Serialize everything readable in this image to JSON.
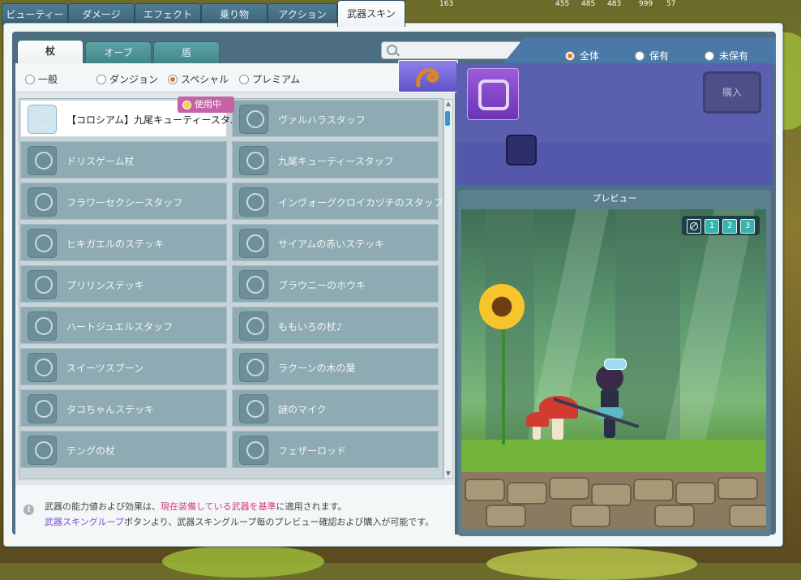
{
  "top_tabs": [
    {
      "label": "ビューティー"
    },
    {
      "label": "ダメージ"
    },
    {
      "label": "エフェクト"
    },
    {
      "label": "乗り物"
    },
    {
      "label": "アクション"
    },
    {
      "label": "武器スキン",
      "active": true
    }
  ],
  "hud_numbers": [
    "163",
    "455",
    "485",
    "483",
    "999",
    "57"
  ],
  "sub_tabs": [
    {
      "label": "杖",
      "active": true
    },
    {
      "label": "オーブ"
    },
    {
      "label": "盾"
    }
  ],
  "search": {
    "placeholder": "",
    "value": ""
  },
  "ownership_filter": [
    {
      "label": "全体",
      "selected": true
    },
    {
      "label": "保有",
      "selected": false
    },
    {
      "label": "未保有",
      "selected": false
    }
  ],
  "category_filter": [
    {
      "label": "一般",
      "selected": false
    },
    {
      "label": "ダンジョン",
      "selected": false
    },
    {
      "label": "スペシャル",
      "selected": true
    },
    {
      "label": "プレミアム",
      "selected": false
    }
  ],
  "in_use_badge": "使用中",
  "items": [
    {
      "name": "【コロシアム】九尾キューティースタ..",
      "selected": true,
      "icon": "staff-blue-icon"
    },
    {
      "name": "ヴァルハラスタッフ",
      "icon": "staff-ring-icon"
    },
    {
      "name": "ドリスゲーム杖",
      "icon": "staff-broom-icon"
    },
    {
      "name": "九尾キューティースタッフ",
      "icon": "staff-fox-icon"
    },
    {
      "name": "フラワーセクシースタッフ",
      "icon": "staff-flower-icon"
    },
    {
      "name": "インヴォーグクロイカヅチのスタッフ",
      "icon": "staff-lightning-icon"
    },
    {
      "name": "ヒキガエルのステッキ",
      "icon": "staff-toad-icon"
    },
    {
      "name": "サイアムの赤いステッキ",
      "icon": "staff-red-icon"
    },
    {
      "name": "プリリンステッキ",
      "icon": "staff-candy-icon"
    },
    {
      "name": "ブラウニーのホウキ",
      "icon": "broom-icon"
    },
    {
      "name": "ハートジュエルスタッフ",
      "icon": "staff-heart-icon"
    },
    {
      "name": "ももいろの杖♪",
      "icon": "staff-pink-icon"
    },
    {
      "name": "スイーツスプーン",
      "icon": "spoon-icon"
    },
    {
      "name": "ラクーンの木の葉",
      "icon": "leaf-icon"
    },
    {
      "name": "タコちゃんステッキ",
      "icon": "octopus-icon"
    },
    {
      "name": "謎のマイク",
      "icon": "microphone-icon"
    },
    {
      "name": "テングの杖",
      "icon": "staff-tengu-icon"
    },
    {
      "name": "フェザーロッド",
      "icon": "feather-icon"
    }
  ],
  "detail": {
    "buy_label": "購入"
  },
  "preview": {
    "header": "プレビュー",
    "motion_buttons": [
      "1",
      "2",
      "3"
    ]
  },
  "notice": {
    "line1_a": "武器の能力値および効果は、",
    "line1_b": "現在装備している武器を基準",
    "line1_c": "に適用されます。",
    "line2_a": "武器スキングループ",
    "line2_b": "ボタンより、武器スキングループ毎のプレビュー確認および購入が可能です。"
  },
  "colors": {
    "accent": "#e27a22",
    "badge": "#c862a8",
    "highlight_text": "#d13c80",
    "link_text": "#7a4bd6",
    "detail_bg": "#5b5fb0"
  }
}
